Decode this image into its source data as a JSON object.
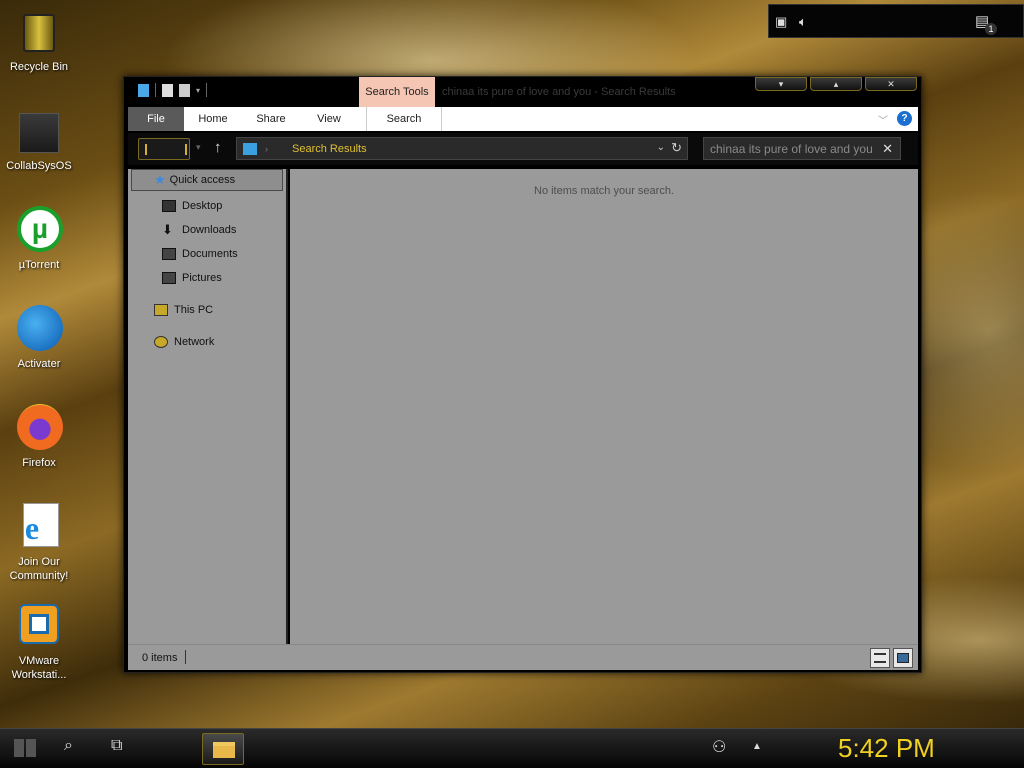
{
  "desktop": {
    "icons": [
      {
        "label": "Recycle Bin"
      },
      {
        "label": "CollabSysOS"
      },
      {
        "label": "µTorrent"
      },
      {
        "label": "Activater"
      },
      {
        "label": "Firefox"
      },
      {
        "label": "Join Our Community!"
      },
      {
        "label": "VMware Workstati..."
      }
    ]
  },
  "window": {
    "contextual_tab": "Search Tools",
    "title": "chinaa its pure of love and you - Search Results",
    "ribbon": {
      "tabs": [
        "File",
        "Home",
        "Share",
        "View",
        "Search"
      ]
    },
    "address": {
      "path": "Search Results"
    },
    "search": {
      "value": "chinaa its pure of love and you"
    },
    "nav": {
      "items": [
        {
          "label": "Quick access",
          "icon": "star-icon"
        },
        {
          "label": "Desktop",
          "icon": "desktop-icon"
        },
        {
          "label": "Downloads",
          "icon": "download-arrow-icon"
        },
        {
          "label": "Documents",
          "icon": "documents-icon"
        },
        {
          "label": "Pictures",
          "icon": "pictures-icon"
        },
        {
          "label": "This PC",
          "icon": "computer-icon"
        },
        {
          "label": "Network",
          "icon": "network-icon"
        }
      ]
    },
    "content": {
      "empty_message": "No items match your search."
    },
    "status": {
      "count": "0 items"
    }
  },
  "taskbar": {
    "clock": "5:42 PM",
    "notification_count": "1"
  },
  "colors": {
    "accent": "#e0c030",
    "context_tab": "#f6c6b4",
    "pane_bg": "#9a9a9a"
  }
}
